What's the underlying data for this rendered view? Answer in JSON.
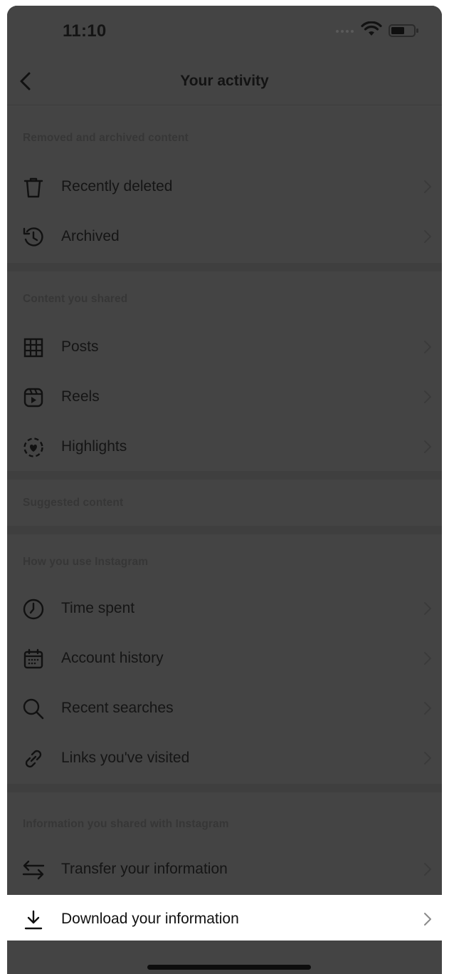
{
  "status_bar": {
    "time": "11:10"
  },
  "header": {
    "title": "Your activity"
  },
  "sections": [
    {
      "header": "Removed and archived content",
      "items": [
        {
          "label": "Recently deleted",
          "icon": "trash-icon"
        },
        {
          "label": "Archived",
          "icon": "archive-history-icon"
        }
      ]
    },
    {
      "header": "Content you shared",
      "items": [
        {
          "label": "Posts",
          "icon": "grid-icon"
        },
        {
          "label": "Reels",
          "icon": "reels-icon"
        },
        {
          "label": "Highlights",
          "icon": "highlights-icon"
        }
      ]
    },
    {
      "header": "Suggested content",
      "items": []
    },
    {
      "header": "How you use Instagram",
      "items": [
        {
          "label": "Time spent",
          "icon": "clock-icon"
        },
        {
          "label": "Account history",
          "icon": "calendar-icon"
        },
        {
          "label": "Recent searches",
          "icon": "search-icon"
        },
        {
          "label": "Links you've visited",
          "icon": "link-icon"
        }
      ]
    },
    {
      "header": "Information you shared with Instagram",
      "items": [
        {
          "label": "Transfer your information",
          "icon": "transfer-icon"
        },
        {
          "label": "Download your information",
          "icon": "download-icon",
          "highlighted": true
        }
      ]
    }
  ],
  "colors": {
    "dim_background": "#444444",
    "highlight_background": "#ffffff",
    "text": "#151515",
    "section_header": "#363636"
  }
}
